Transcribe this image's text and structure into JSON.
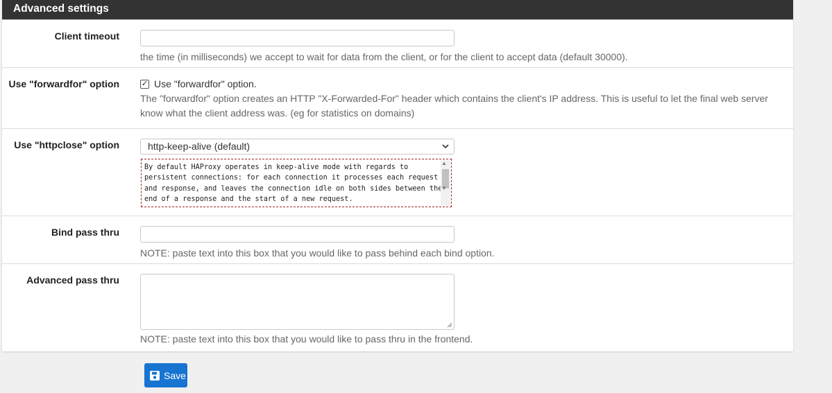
{
  "panel": {
    "title": "Advanced settings"
  },
  "client_timeout": {
    "label": "Client timeout",
    "value": "",
    "help": "the time (in milliseconds) we accept to wait for data from the client, or for the client to accept data (default 30000)."
  },
  "forwardfor": {
    "label": "Use \"forwardfor\" option",
    "checkbox_label": "Use \"forwardfor\" option.",
    "checked": true,
    "help_line1": "The \"forwardfor\" option creates an HTTP \"X-Forwarded-For\" header which contains the client's IP address. This is useful to let the final web server",
    "help_line2": "know what the client address was. (eg for statistics on domains)"
  },
  "httpclose": {
    "label": "Use \"httpclose\" option",
    "selected": "http-keep-alive (default)",
    "description_lines": [
      "By default HAProxy operates in keep-alive mode with regards to",
      "persistent connections: for each connection it processes each request",
      "and response, and leaves the connection idle on both sides between the",
      "end of a response and the start of a new request."
    ]
  },
  "bind_pass_thru": {
    "label": "Bind pass thru",
    "value": "",
    "help": "NOTE: paste text into this box that you would like to pass behind each bind option."
  },
  "advanced_pass_thru": {
    "label": "Advanced pass thru",
    "value": "",
    "help": "NOTE: paste text into this box that you would like to pass thru in the frontend."
  },
  "save": {
    "label": "Save"
  },
  "colors": {
    "heading_bg": "#333333",
    "save_bg": "#1775d1",
    "info_border": "#a02020"
  }
}
